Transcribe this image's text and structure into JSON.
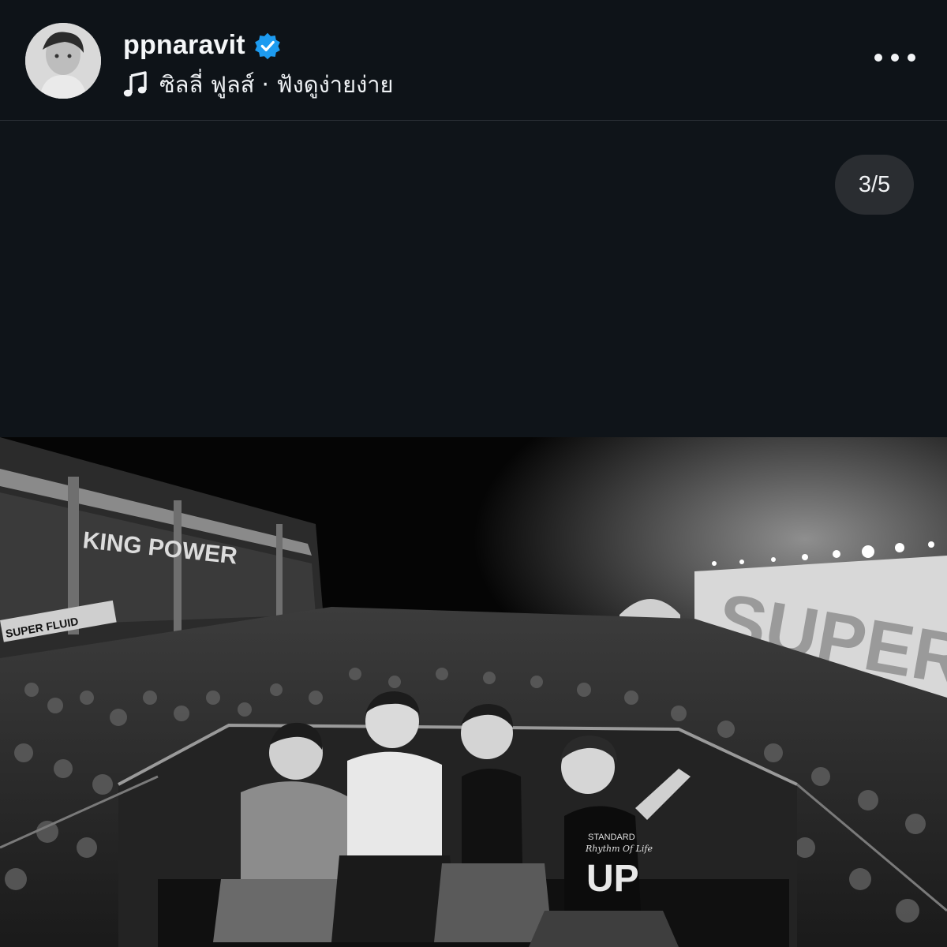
{
  "header": {
    "username": "ppnaravit",
    "verified": true,
    "audio_label": "ซิลลี่ ฟูลส์ · ฟังดูง่ายง่าย",
    "more_icon": "more-horizontal-icon"
  },
  "media": {
    "counter": "3/5",
    "photo_signage": {
      "building_sign": "KING POWER",
      "stage_sign": "SUPER",
      "banner_sign": "SUPER FLUID"
    },
    "shirt_text": {
      "line1": "STANDARD",
      "line2": "Rhythm Of Life",
      "line3": "UP"
    }
  },
  "colors": {
    "background": "#0f1419",
    "verified_badge": "#1d9bf0",
    "counter_bg": "#2a2d31"
  }
}
